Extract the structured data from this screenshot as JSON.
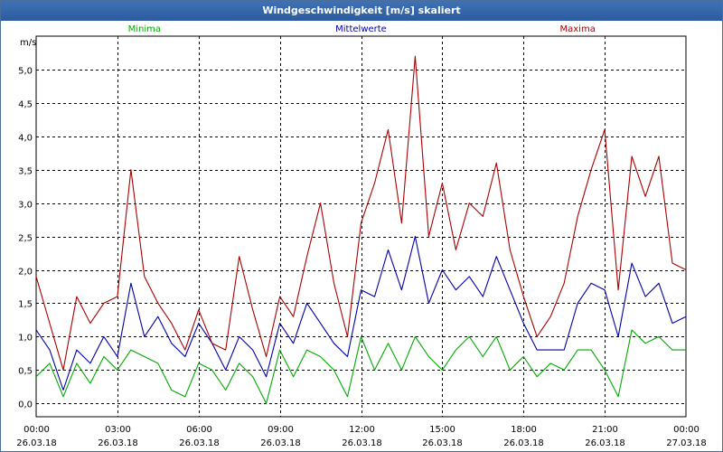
{
  "window": {
    "title": "Windgeschwindigkeit [m/s] skaliert"
  },
  "chart_data": {
    "type": "line",
    "title": "Windgeschwindigkeit [m/s] skaliert",
    "ylabel": "m/s",
    "ylim": [
      -0.2,
      5.5
    ],
    "xlim": [
      0,
      24
    ],
    "y_ticks": [
      "0,0",
      "0,5",
      "1,0",
      "1,5",
      "2,0",
      "2,5",
      "3,0",
      "3,5",
      "4,0",
      "4,5",
      "5,0"
    ],
    "y_tick_values": [
      0,
      0.5,
      1,
      1.5,
      2,
      2.5,
      3,
      3.5,
      4,
      4.5,
      5
    ],
    "x_ticks": [
      {
        "time": "00:00",
        "date": "26.03.18"
      },
      {
        "time": "03:00",
        "date": "26.03.18"
      },
      {
        "time": "06:00",
        "date": "26.03.18"
      },
      {
        "time": "09:00",
        "date": "26.03.18"
      },
      {
        "time": "12:00",
        "date": "26.03.18"
      },
      {
        "time": "15:00",
        "date": "26.03.18"
      },
      {
        "time": "18:00",
        "date": "26.03.18"
      },
      {
        "time": "21:00",
        "date": "26.03.18"
      },
      {
        "time": "00:00",
        "date": "27.03.18"
      }
    ],
    "x_tick_hours": [
      0,
      3,
      6,
      9,
      12,
      15,
      18,
      21,
      24
    ],
    "grid": true,
    "legend_position": "top",
    "series": [
      {
        "name": "Minima",
        "color": "#00aa00",
        "x": [
          0,
          0.5,
          1,
          1.5,
          2,
          2.5,
          3,
          3.5,
          4,
          4.5,
          5,
          5.5,
          6,
          6.5,
          7,
          7.5,
          8,
          8.5,
          9,
          9.5,
          10,
          10.5,
          11,
          11.5,
          12,
          12.5,
          13,
          13.5,
          14,
          14.5,
          15,
          15.5,
          16,
          16.5,
          17,
          17.5,
          18,
          18.5,
          19,
          19.5,
          20,
          20.5,
          21,
          21.5,
          22,
          22.5,
          23,
          23.5,
          24
        ],
        "values": [
          0.4,
          0.6,
          0.1,
          0.6,
          0.3,
          0.7,
          0.5,
          0.8,
          0.7,
          0.6,
          0.2,
          0.1,
          0.6,
          0.5,
          0.2,
          0.6,
          0.4,
          0.0,
          0.8,
          0.4,
          0.8,
          0.7,
          0.5,
          0.1,
          1.0,
          0.5,
          0.9,
          0.5,
          1.0,
          0.7,
          0.5,
          0.8,
          1.0,
          0.7,
          1.0,
          0.5,
          0.7,
          0.4,
          0.6,
          0.5,
          0.8,
          0.8,
          0.5,
          0.1,
          1.1,
          0.9,
          1.0,
          0.8,
          0.8
        ]
      },
      {
        "name": "Mittelwerte",
        "color": "#0000aa",
        "x": [
          0,
          0.5,
          1,
          1.5,
          2,
          2.5,
          3,
          3.5,
          4,
          4.5,
          5,
          5.5,
          6,
          6.5,
          7,
          7.5,
          8,
          8.5,
          9,
          9.5,
          10,
          10.5,
          11,
          11.5,
          12,
          12.5,
          13,
          13.5,
          14,
          14.5,
          15,
          15.5,
          16,
          16.5,
          17,
          17.5,
          18,
          18.5,
          19,
          19.5,
          20,
          20.5,
          21,
          21.5,
          22,
          22.5,
          23,
          23.5,
          24
        ],
        "values": [
          1.1,
          0.8,
          0.2,
          0.8,
          0.6,
          1.0,
          0.7,
          1.8,
          1.0,
          1.3,
          0.9,
          0.7,
          1.2,
          0.9,
          0.5,
          1.0,
          0.8,
          0.4,
          1.2,
          0.9,
          1.5,
          1.2,
          0.9,
          0.7,
          1.7,
          1.6,
          2.3,
          1.7,
          2.5,
          1.5,
          2.0,
          1.7,
          1.9,
          1.6,
          2.2,
          1.7,
          1.2,
          0.8,
          0.8,
          0.8,
          1.5,
          1.8,
          1.7,
          1.0,
          2.1,
          1.6,
          1.8,
          1.2,
          1.3
        ]
      },
      {
        "name": "Maxima",
        "color": "#aa0000",
        "x": [
          0,
          0.5,
          1,
          1.5,
          2,
          2.5,
          3,
          3.5,
          4,
          4.5,
          5,
          5.5,
          6,
          6.5,
          7,
          7.5,
          8,
          8.5,
          9,
          9.5,
          10,
          10.5,
          11,
          11.5,
          12,
          12.5,
          13,
          13.5,
          14,
          14.5,
          15,
          15.5,
          16,
          16.5,
          17,
          17.5,
          18,
          18.5,
          19,
          19.5,
          20,
          20.5,
          21,
          21.5,
          22,
          22.5,
          23,
          23.5,
          24
        ],
        "values": [
          1.9,
          1.2,
          0.5,
          1.6,
          1.2,
          1.5,
          1.6,
          3.5,
          1.9,
          1.5,
          1.2,
          0.8,
          1.4,
          0.9,
          0.8,
          2.2,
          1.4,
          0.7,
          1.6,
          1.3,
          2.2,
          3.0,
          1.8,
          1.0,
          2.7,
          3.3,
          4.1,
          2.7,
          5.2,
          2.5,
          3.3,
          2.3,
          3.0,
          2.8,
          3.6,
          2.3,
          1.6,
          1.0,
          1.3,
          1.8,
          2.8,
          3.5,
          4.1,
          1.7,
          3.7,
          3.1,
          3.7,
          2.1,
          2.0
        ]
      }
    ]
  }
}
